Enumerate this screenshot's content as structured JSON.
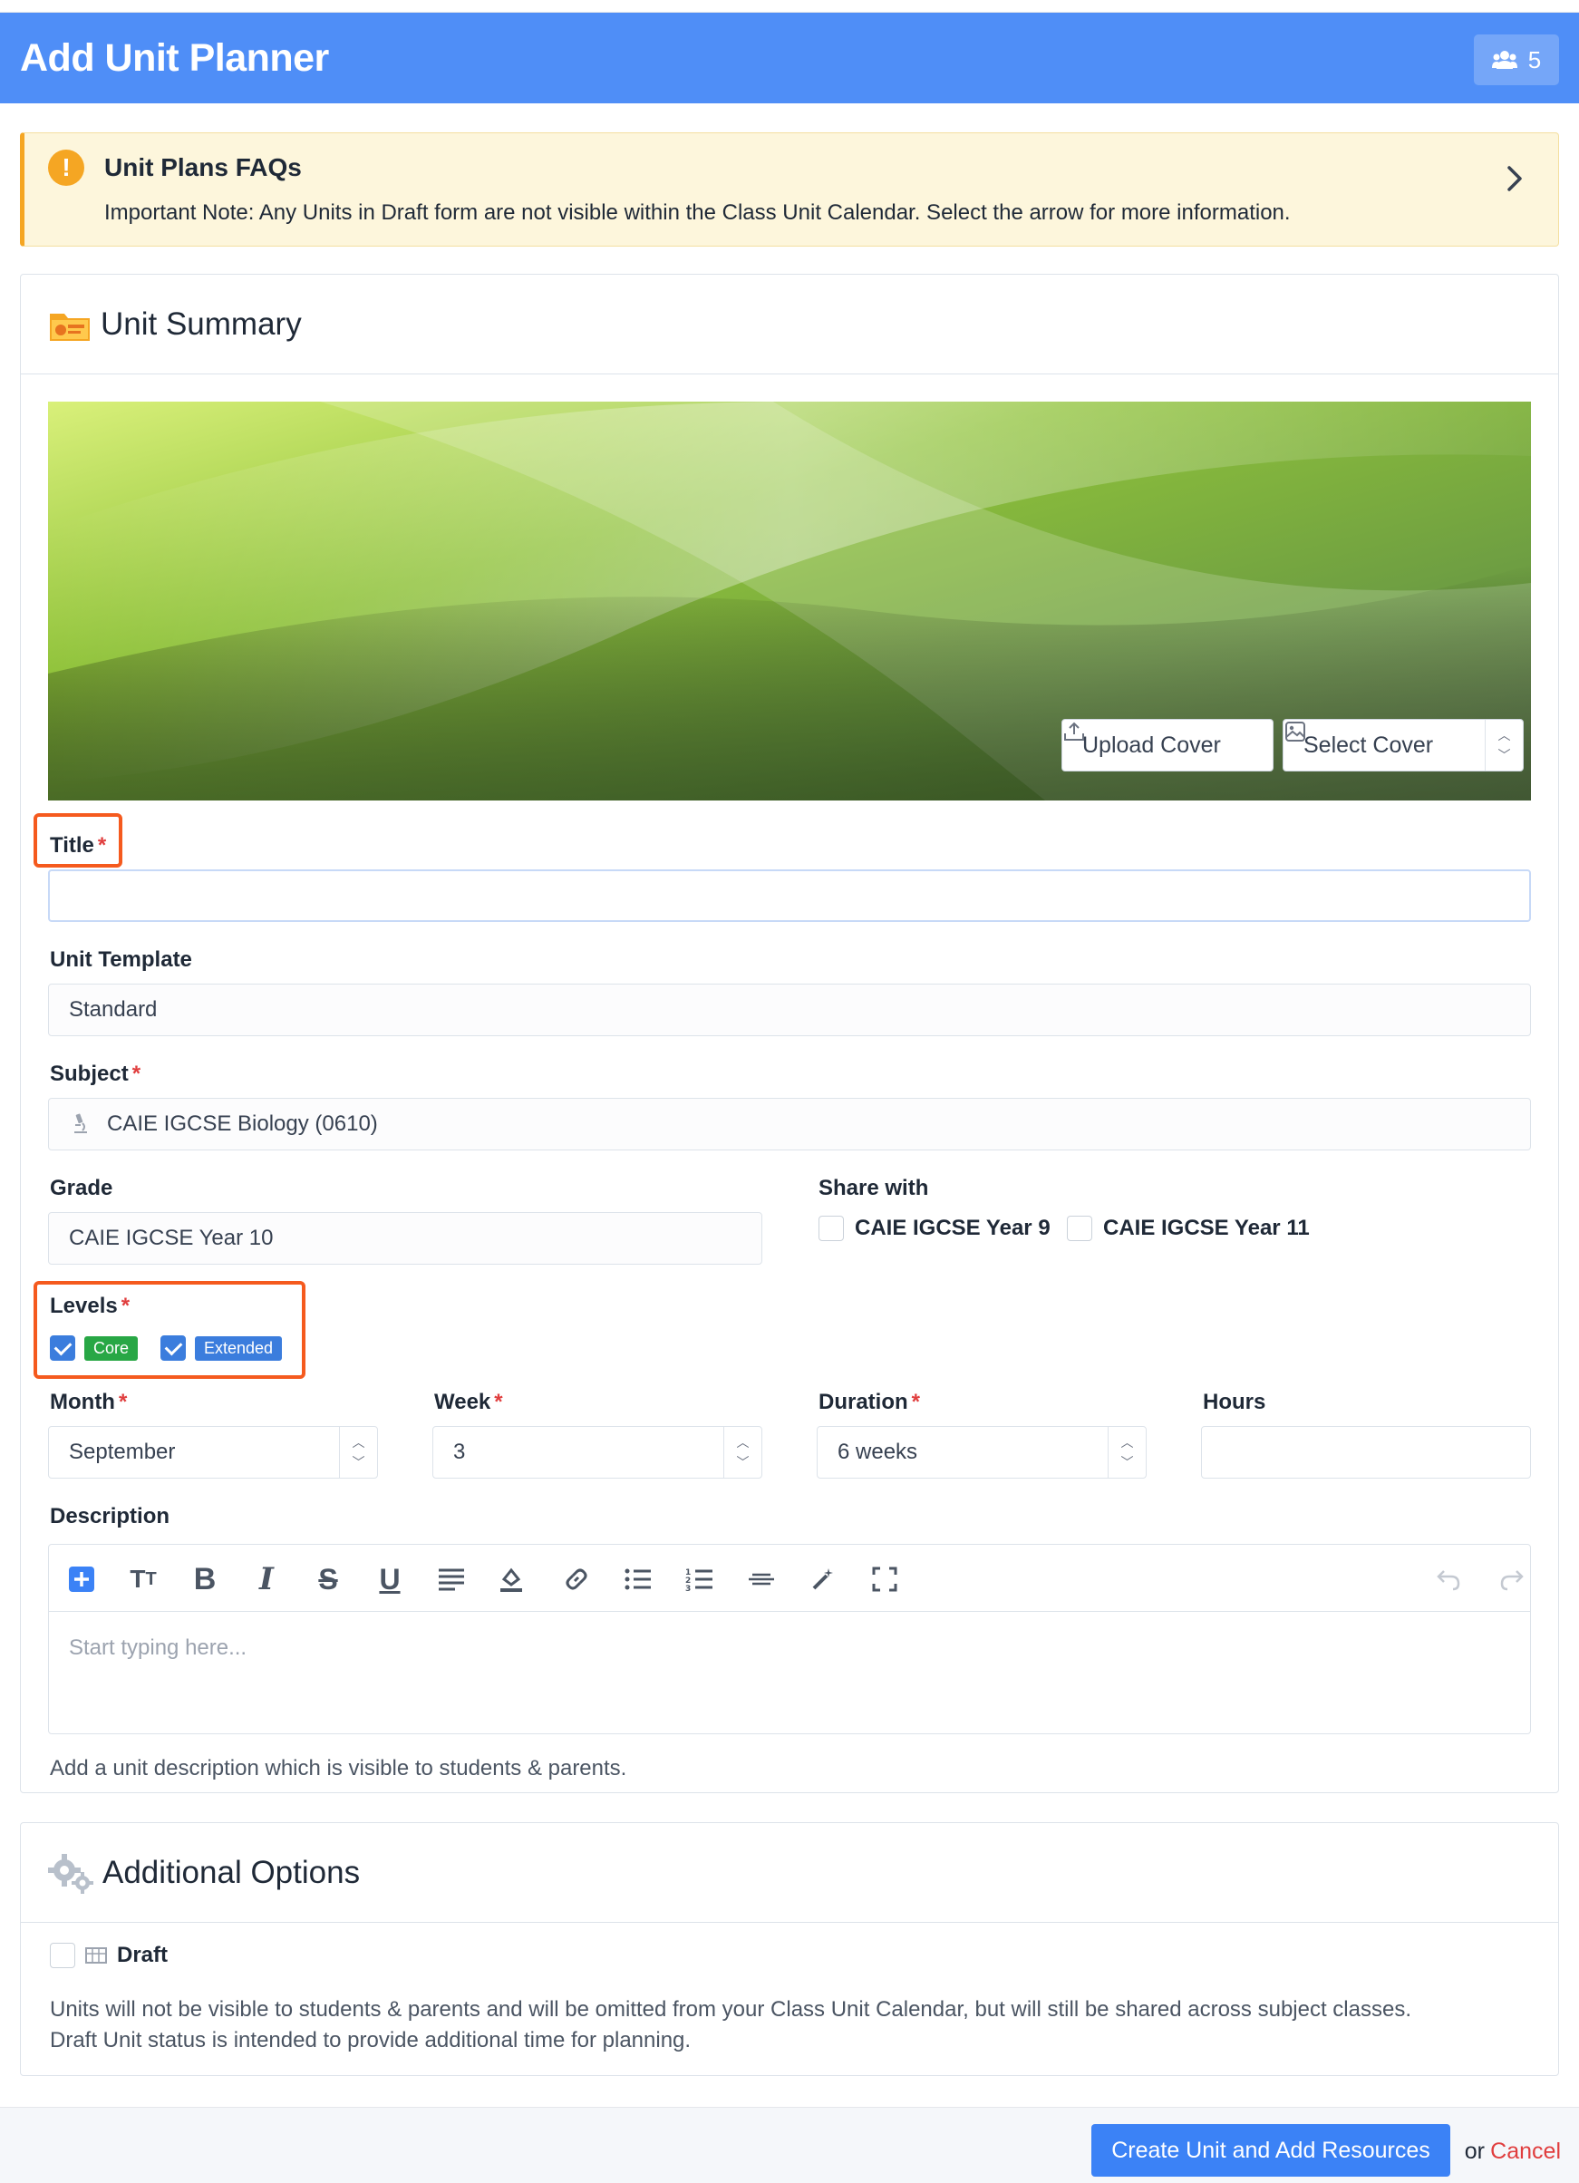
{
  "header": {
    "title": "Add Unit Planner",
    "users_count": "5"
  },
  "alert": {
    "title": "Unit Plans FAQs",
    "note": "Important Note: Any Units in Draft form are not visible within the Class Unit Calendar. Select the arrow for more information."
  },
  "unit_summary": {
    "heading": "Unit Summary",
    "upload_cover": "Upload Cover",
    "select_cover": "Select Cover",
    "title_label": "Title",
    "title_value": "",
    "template_label": "Unit Template",
    "template_value": "Standard",
    "subject_label": "Subject",
    "subject_value": "CAIE IGCSE Biology (0610)",
    "grade_label": "Grade",
    "grade_value": "CAIE IGCSE Year 10",
    "share_label": "Share with",
    "share_options": [
      {
        "label": "CAIE IGCSE Year 9",
        "checked": false
      },
      {
        "label": "CAIE IGCSE Year 11",
        "checked": false
      }
    ],
    "levels_label": "Levels",
    "levels": [
      {
        "label": "Core",
        "checked": true,
        "color": "#28a745"
      },
      {
        "label": "Extended",
        "checked": true,
        "color": "#3b7ddd"
      }
    ],
    "month_label": "Month",
    "month_value": "September",
    "week_label": "Week",
    "week_value": "3",
    "duration_label": "Duration",
    "duration_value": "6 weeks",
    "hours_label": "Hours",
    "hours_value": "",
    "description_label": "Description",
    "description_placeholder": "Start typing here...",
    "description_help": "Add a unit description which is visible to students & parents."
  },
  "additional": {
    "heading": "Additional Options",
    "draft_label": "Draft",
    "draft_checked": false,
    "draft_help_1": "Units will not be visible to students & parents and will be omitted from your Class Unit Calendar, but will still be shared across subject classes.",
    "draft_help_2": "Draft Unit status is intended to provide additional time for planning."
  },
  "footer": {
    "primary": "Create Unit and Add Resources",
    "or": "or",
    "cancel": "Cancel"
  },
  "colors": {
    "header": "#4f8ef7",
    "primary": "#3b82f6",
    "required": "#e03e3e",
    "annotation": "#f55a1e",
    "warning": "#f5a623"
  }
}
